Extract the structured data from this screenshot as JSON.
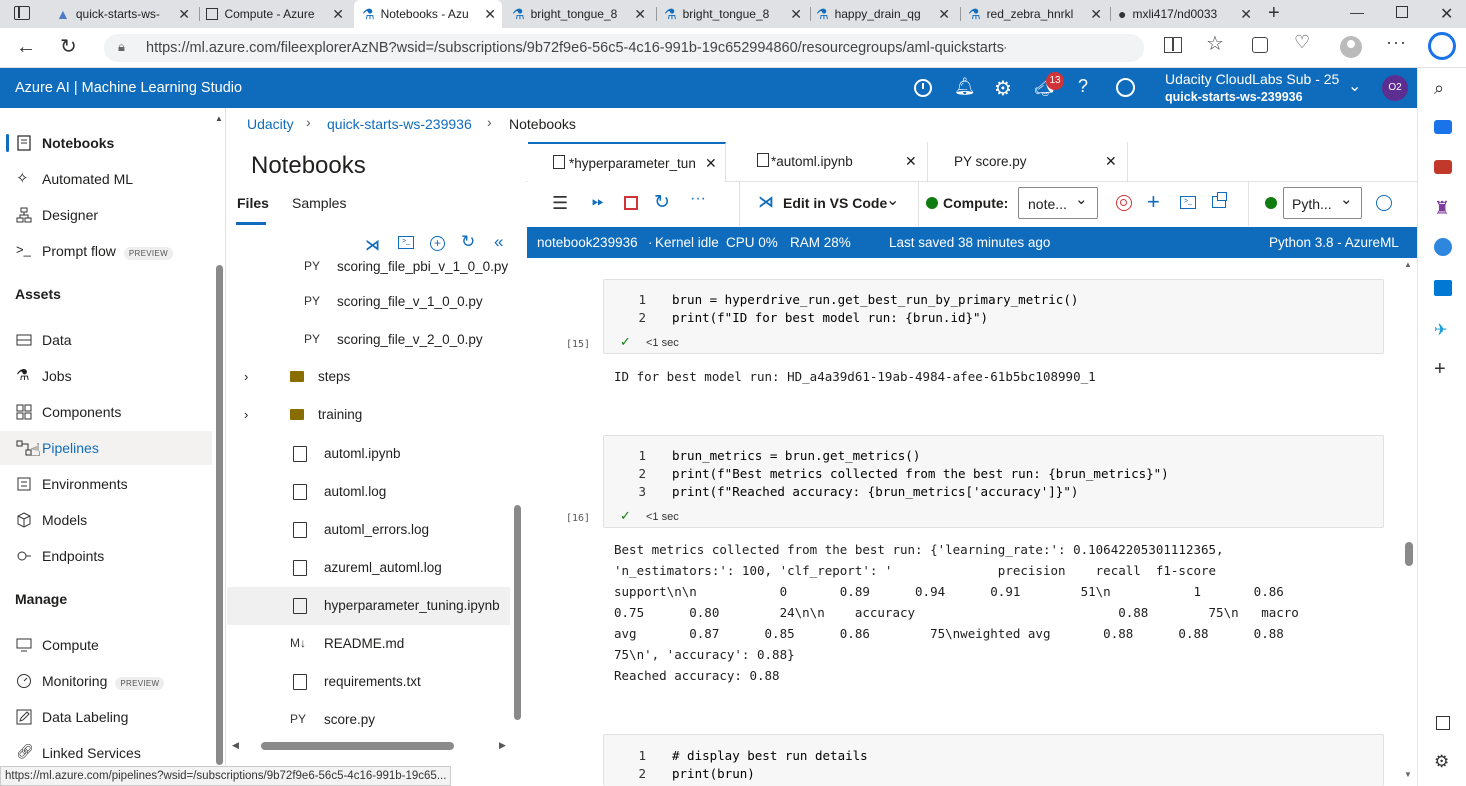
{
  "browser": {
    "tabs": [
      {
        "label": "quick-starts-ws-"
      },
      {
        "label": "Compute - Azure"
      },
      {
        "label": "Notebooks - Azu"
      },
      {
        "label": "bright_tongue_8"
      },
      {
        "label": "bright_tongue_8"
      },
      {
        "label": "happy_drain_qg"
      },
      {
        "label": "red_zebra_hnrkl"
      },
      {
        "label": "mxli417/nd0033"
      }
    ],
    "url": "https://ml.azure.com/fileexplorerAzNB?wsid=/subscriptions/9b72f9e6-56c5-4c16-991b-19c652994860/resourcegroups/aml-quickstarts-239936/pr...",
    "status_url": "https://ml.azure.com/pipelines?wsid=/subscriptions/9b72f9e6-56c5-4c16-991b-19c65..."
  },
  "header": {
    "app_title": "Azure AI | Machine Learning Studio",
    "notifications_badge": "13",
    "subscription": "Udacity CloudLabs Sub - 25",
    "workspace": "quick-starts-ws-239936",
    "avatar": "O2"
  },
  "sidebar": {
    "items": [
      {
        "label": "Notebooks"
      },
      {
        "label": "Automated ML"
      },
      {
        "label": "Designer"
      },
      {
        "label": "Prompt flow",
        "badge": "PREVIEW"
      }
    ],
    "assets_header": "Assets",
    "assets": [
      {
        "label": "Data"
      },
      {
        "label": "Jobs"
      },
      {
        "label": "Components"
      },
      {
        "label": "Pipelines"
      },
      {
        "label": "Environments"
      },
      {
        "label": "Models"
      },
      {
        "label": "Endpoints"
      }
    ],
    "manage_header": "Manage",
    "manage": [
      {
        "label": "Compute"
      },
      {
        "label": "Monitoring",
        "badge": "PREVIEW"
      },
      {
        "label": "Data Labeling"
      },
      {
        "label": "Linked Services"
      }
    ]
  },
  "breadcrumb": {
    "items": [
      "Udacity",
      "quick-starts-ws-239936",
      "Notebooks"
    ]
  },
  "files_panel": {
    "title": "Notebooks",
    "tabs": [
      "Files",
      "Samples"
    ],
    "rows": [
      {
        "icon": "PY",
        "name": "scoring_file_pbi_v_1_0_0.py"
      },
      {
        "icon": "PY",
        "name": "scoring_file_v_1_0_0.py"
      },
      {
        "icon": "PY",
        "name": "scoring_file_v_2_0_0.py"
      },
      {
        "icon": "folder",
        "name": "steps"
      },
      {
        "icon": "folder",
        "name": "training"
      },
      {
        "icon": "notebook",
        "name": "automl.ipynb"
      },
      {
        "icon": "file",
        "name": "automl.log"
      },
      {
        "icon": "file",
        "name": "automl_errors.log"
      },
      {
        "icon": "file",
        "name": "azureml_automl.log"
      },
      {
        "icon": "notebook",
        "name": "hyperparameter_tuning.ipynb"
      },
      {
        "icon": "M↓",
        "name": "README.md"
      },
      {
        "icon": "file",
        "name": "requirements.txt"
      },
      {
        "icon": "PY",
        "name": "score.py"
      }
    ]
  },
  "editor": {
    "tabs": [
      {
        "label": "*hyperparameter_tun"
      },
      {
        "label": "*automl.ipynb"
      },
      {
        "label": "PY score.py"
      }
    ],
    "toolbar": {
      "edit_vscode": "Edit in VS Code",
      "compute_label": "Compute:",
      "compute_value": "note...",
      "kernel_value": "Pyth..."
    },
    "status": {
      "notebook": "notebook239936",
      "kernel": "Kernel idle",
      "cpu": "CPU  0%",
      "ram": "RAM 28%",
      "saved": "Last saved 38 minutes ago",
      "python": "Python 3.8 - AzureML"
    },
    "cells": [
      {
        "count": "[15]",
        "time": "<1 sec",
        "lines": [
          "brun = hyperdrive_run.get_best_run_by_primary_metric()",
          "print(f\"ID for best model run: {brun.id}\")"
        ],
        "output": "ID for best model run: HD_a4a39d61-19ab-4984-afee-61b5bc108990_1"
      },
      {
        "count": "[16]",
        "time": "<1 sec",
        "lines": [
          "brun_metrics = brun.get_metrics()",
          "print(f\"Best metrics collected from the best run: {brun_metrics}\")",
          "print(f\"Reached accuracy: {brun_metrics['accuracy']}\")"
        ],
        "output": "Best metrics collected from the best run: {'learning_rate:': 0.10642205301112365,\n'n_estimators:': 100, 'clf_report': '              precision    recall  f1-score\nsupport\\n\\n           0       0.89      0.94      0.91        51\\n           1       0.86\n0.75      0.80        24\\n\\n    accuracy                           0.88        75\\n   macro\navg       0.87      0.85      0.86        75\\nweighted avg       0.88      0.88      0.88\n75\\n', 'accuracy': 0.88}\nReached accuracy: 0.88"
      },
      {
        "lines": [
          "# display best run details",
          "print(brun)"
        ]
      }
    ]
  }
}
